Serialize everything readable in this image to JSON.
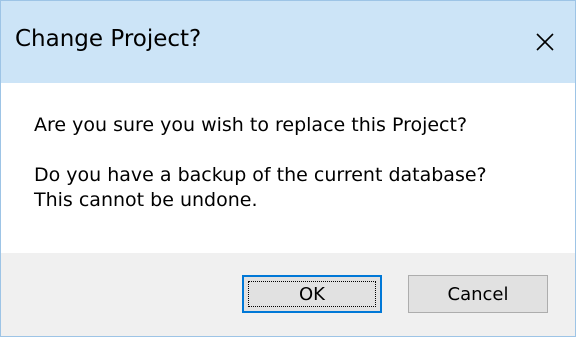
{
  "dialog": {
    "title": "Change Project?",
    "close_icon": "close-x-icon",
    "messages": [
      "Are you sure you wish to replace this Project?",
      "Do you have a backup of the current database?",
      "This cannot be undone."
    ],
    "buttons": {
      "ok_label": "OK",
      "cancel_label": "Cancel"
    }
  },
  "colors": {
    "titlebar": "#cce4f7",
    "footer": "#f0f0f0",
    "default_button_border": "#0078d7"
  }
}
